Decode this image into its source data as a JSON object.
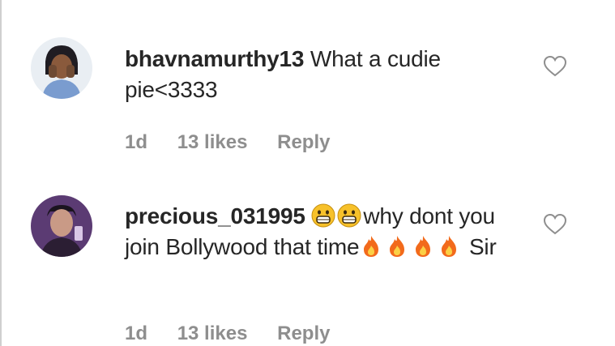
{
  "comments": [
    {
      "username": "bhavnamurthy13",
      "text_parts": [
        "What a cudie pie<3333"
      ],
      "time": "1d",
      "likes": "13 likes",
      "reply": "Reply",
      "avatar_icon": "user-avatar-photo",
      "like_icon": "heart-outline-icon"
    },
    {
      "username": "precious_031995",
      "text_parts": [
        "why dont you join Bollywood that time",
        "Sir"
      ],
      "emojis": [
        "grinning-face-icon",
        "fire-icon"
      ],
      "time": "1d",
      "likes": "13 likes",
      "reply": "Reply",
      "avatar_icon": "user-avatar-photo",
      "like_icon": "heart-outline-icon"
    }
  ],
  "colors": {
    "text": "#262626",
    "meta": "#8e8e8e",
    "heart_stroke": "#8e8e8e",
    "avatar2_bg": "#5b3b73"
  }
}
